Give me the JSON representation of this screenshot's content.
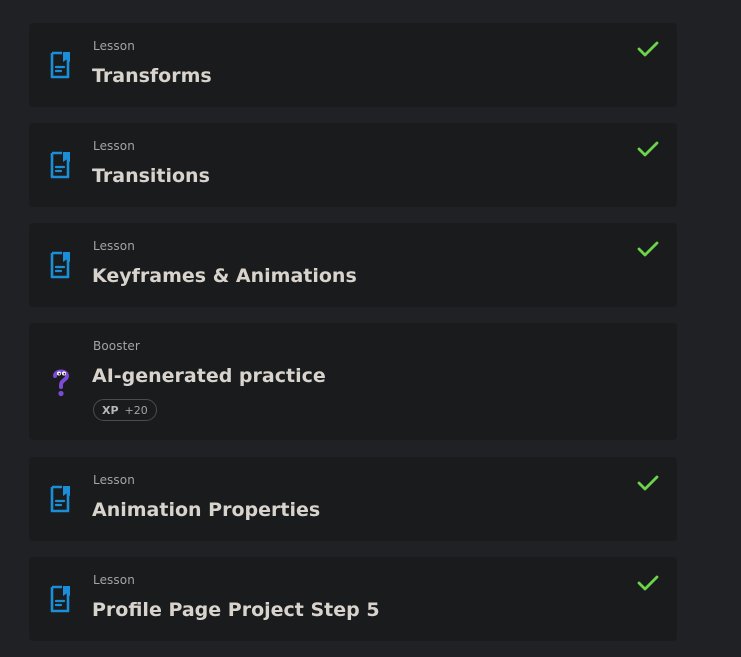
{
  "colors": {
    "background": "#202124",
    "card": "#1a1b1d",
    "lesson_icon": "#1a8fd8",
    "check": "#6bd44a",
    "booster_icon": "#7b4ad6"
  },
  "items": [
    {
      "kind": "Lesson",
      "title": "Transforms",
      "completed": true,
      "icon": "lesson-document-icon"
    },
    {
      "kind": "Lesson",
      "title": "Transitions",
      "completed": true,
      "icon": "lesson-document-icon"
    },
    {
      "kind": "Lesson",
      "title": "Keyframes & Animations",
      "completed": true,
      "icon": "lesson-document-icon"
    },
    {
      "kind": "Booster",
      "title": "AI-generated practice",
      "completed": false,
      "icon": "question-mark-icon",
      "xp_label": "XP",
      "xp_value": "+20"
    },
    {
      "kind": "Lesson",
      "title": "Animation Properties",
      "completed": true,
      "icon": "lesson-document-icon"
    },
    {
      "kind": "Lesson",
      "title": "Profile Page Project Step 5",
      "completed": true,
      "icon": "lesson-document-icon"
    }
  ]
}
